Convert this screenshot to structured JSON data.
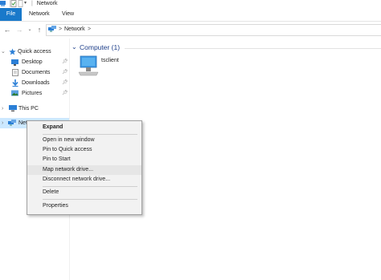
{
  "window": {
    "title": "Network",
    "title_separator": "|"
  },
  "ribbon": {
    "tabs": [
      {
        "label": "File"
      },
      {
        "label": "Network"
      },
      {
        "label": "View"
      }
    ]
  },
  "address_bar": {
    "segments": [
      "Network"
    ],
    "separator": ">"
  },
  "nav_pane": {
    "items": [
      {
        "label": "Quick access",
        "icon": "star-icon",
        "expanded": true
      },
      {
        "label": "Desktop",
        "icon": "desktop-folder-icon",
        "pinned": true
      },
      {
        "label": "Documents",
        "icon": "documents-folder-icon",
        "pinned": true
      },
      {
        "label": "Downloads",
        "icon": "downloads-folder-icon",
        "pinned": true
      },
      {
        "label": "Pictures",
        "icon": "pictures-folder-icon",
        "pinned": true
      },
      {
        "label": "This PC",
        "icon": "computer-icon"
      },
      {
        "label": "Netw",
        "icon": "network-icon",
        "selected": true
      }
    ]
  },
  "content": {
    "group": {
      "label": "Computer (1)"
    },
    "items": [
      {
        "label": "tsclient",
        "icon": "computer-icon"
      }
    ]
  },
  "context_menu": {
    "items": [
      {
        "label": "Expand",
        "bold": true
      },
      {
        "label": "Open in new window"
      },
      {
        "label": "Pin to Quick access"
      },
      {
        "label": "Pin to Start"
      },
      {
        "label": "Map network drive...",
        "highlighted": true
      },
      {
        "label": "Disconnect network drive..."
      },
      {
        "label": "Delete"
      },
      {
        "label": "Properties"
      }
    ]
  },
  "colors": {
    "file_tab": "#1979ca",
    "group_header": "#1e3f8a",
    "folder_yellow": "#f3c94f",
    "accent_blue": "#2b7fd6"
  }
}
